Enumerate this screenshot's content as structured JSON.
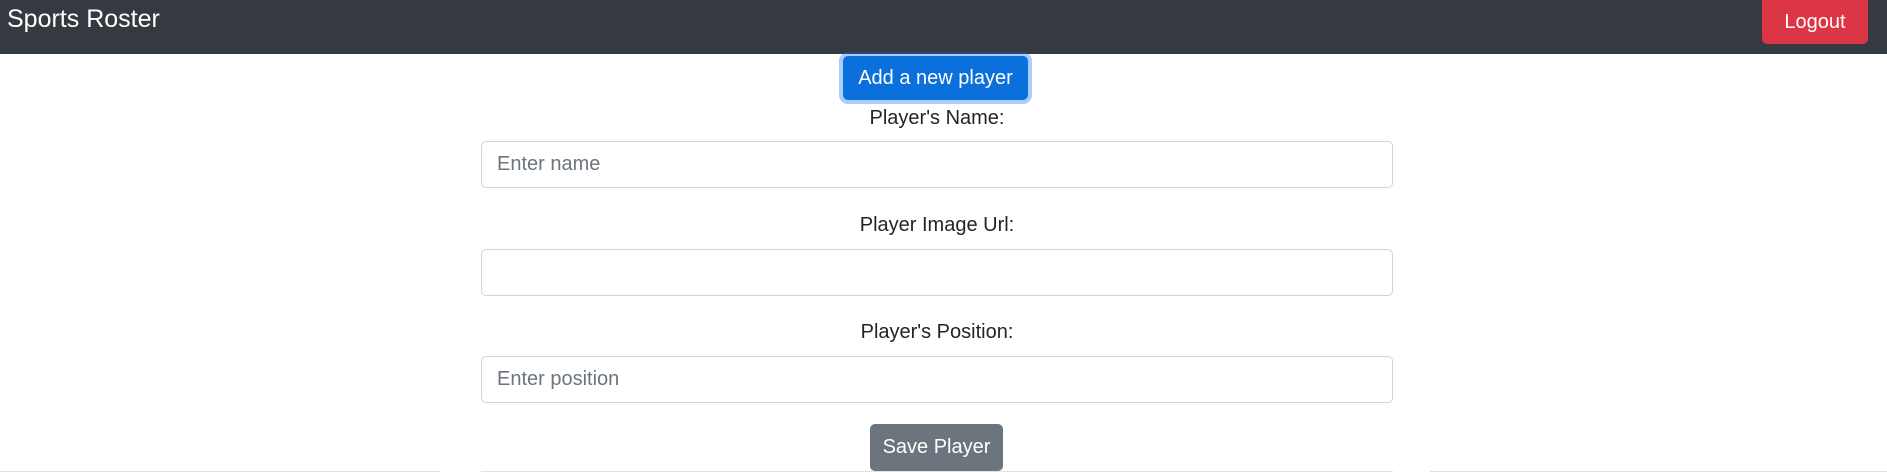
{
  "navbar": {
    "brand": "Sports Roster",
    "logout_label": "Logout"
  },
  "form": {
    "add_button_label": "Add a new player",
    "name_label": "Player's Name:",
    "name_placeholder": "Enter name",
    "name_value": "",
    "image_label": "Player Image Url:",
    "image_placeholder": "",
    "image_value": "",
    "position_label": "Player's Position:",
    "position_placeholder": "Enter position",
    "position_value": "",
    "save_button_label": "Save Player"
  },
  "colors": {
    "navbar_bg": "#343a40",
    "logout_bg": "#dc3545",
    "primary_button_bg": "#0b6fdc",
    "secondary_button_bg": "#6c757d"
  }
}
